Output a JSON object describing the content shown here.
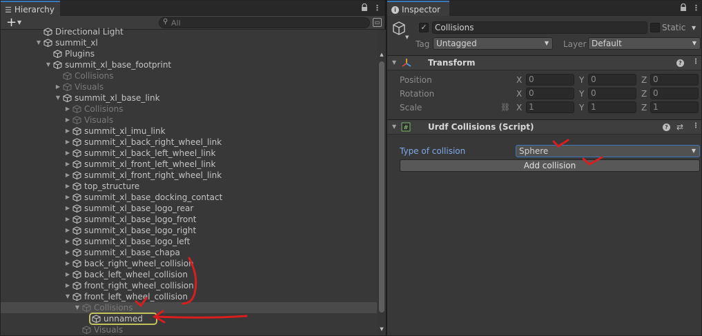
{
  "hierarchy": {
    "tab_label": "Hierarchy",
    "search_placeholder": "All",
    "rows": [
      {
        "label": "Directional Light",
        "depth": 3,
        "arrow": "",
        "dim": false
      },
      {
        "label": "summit_xl",
        "depth": 3,
        "arrow": "down",
        "dim": false
      },
      {
        "label": "Plugins",
        "depth": 4,
        "arrow": "",
        "dim": false
      },
      {
        "label": "summit_xl_base_footprint",
        "depth": 4,
        "arrow": "down",
        "dim": false
      },
      {
        "label": "Collisions",
        "depth": 5,
        "arrow": "",
        "dim": true
      },
      {
        "label": "Visuals",
        "depth": 5,
        "arrow": "right",
        "dim": true
      },
      {
        "label": "summit_xl_base_link",
        "depth": 5,
        "arrow": "down",
        "dim": false
      },
      {
        "label": "Collisions",
        "depth": 6,
        "arrow": "right",
        "dim": true
      },
      {
        "label": "Visuals",
        "depth": 6,
        "arrow": "right",
        "dim": true
      },
      {
        "label": "summit_xl_imu_link",
        "depth": 6,
        "arrow": "right",
        "dim": false
      },
      {
        "label": "summit_xl_back_right_wheel_link",
        "depth": 6,
        "arrow": "right",
        "dim": false
      },
      {
        "label": "summit_xl_back_left_wheel_link",
        "depth": 6,
        "arrow": "right",
        "dim": false
      },
      {
        "label": "summit_xl_front_left_wheel_link",
        "depth": 6,
        "arrow": "right",
        "dim": false
      },
      {
        "label": "summit_xl_front_right_wheel_link",
        "depth": 6,
        "arrow": "right",
        "dim": false
      },
      {
        "label": "top_structure",
        "depth": 6,
        "arrow": "right",
        "dim": false
      },
      {
        "label": "summit_xl_base_docking_contact",
        "depth": 6,
        "arrow": "right",
        "dim": false
      },
      {
        "label": "summit_xl_base_logo_rear",
        "depth": 6,
        "arrow": "right",
        "dim": false
      },
      {
        "label": "summit_xl_base_logo_front",
        "depth": 6,
        "arrow": "right",
        "dim": false
      },
      {
        "label": "summit_xl_base_logo_right",
        "depth": 6,
        "arrow": "right",
        "dim": false
      },
      {
        "label": "summit_xl_base_logo_left",
        "depth": 6,
        "arrow": "right",
        "dim": false
      },
      {
        "label": "summit_xl_base_chapa",
        "depth": 6,
        "arrow": "right",
        "dim": false
      },
      {
        "label": "back_right_wheel_collision",
        "depth": 6,
        "arrow": "right",
        "dim": false
      },
      {
        "label": "back_left_wheel_collision",
        "depth": 6,
        "arrow": "right",
        "dim": false
      },
      {
        "label": "front_right_wheel_collision",
        "depth": 6,
        "arrow": "right",
        "dim": false
      },
      {
        "label": "front_left_wheel_collision",
        "depth": 6,
        "arrow": "down",
        "dim": false
      },
      {
        "label": "Collisions",
        "depth": 7,
        "arrow": "down",
        "dim": true,
        "selected_parent": true
      },
      {
        "label": "unnamed",
        "depth": 8,
        "arrow": "",
        "dim": false,
        "selected": true
      },
      {
        "label": "Visuals",
        "depth": 7,
        "arrow": "",
        "dim": true
      }
    ]
  },
  "inspector": {
    "tab_label": "Inspector",
    "object_name": "Collisions",
    "active": true,
    "static_label": "Static",
    "tag_label": "Tag",
    "tag_value": "Untagged",
    "layer_label": "Layer",
    "layer_value": "Default",
    "transform": {
      "title": "Transform",
      "position_label": "Position",
      "rotation_label": "Rotation",
      "scale_label": "Scale",
      "x": "X",
      "y": "Y",
      "z": "Z",
      "position": [
        "0",
        "0",
        "0"
      ],
      "rotation": [
        "0",
        "0",
        "0"
      ],
      "scale": [
        "1",
        "1",
        "1"
      ]
    },
    "urdf": {
      "title": "Urdf Collisions (Script)",
      "type_label": "Type of collision",
      "type_value": "Sphere",
      "add_button": "Add collision"
    }
  },
  "colors": {
    "accent": "#3a79bb",
    "selected_outline": "#c3c460",
    "annotation": "#d81e1e",
    "link_label": "#7fa8e8"
  },
  "icons": [
    "hamburger-icon",
    "lock-icon",
    "kebab-icon",
    "info-icon",
    "plus-icon",
    "search-icon",
    "cube-icon",
    "checkmark-icon",
    "help-icon",
    "settings-icon",
    "transform-icon",
    "script-icon",
    "link-icon"
  ]
}
